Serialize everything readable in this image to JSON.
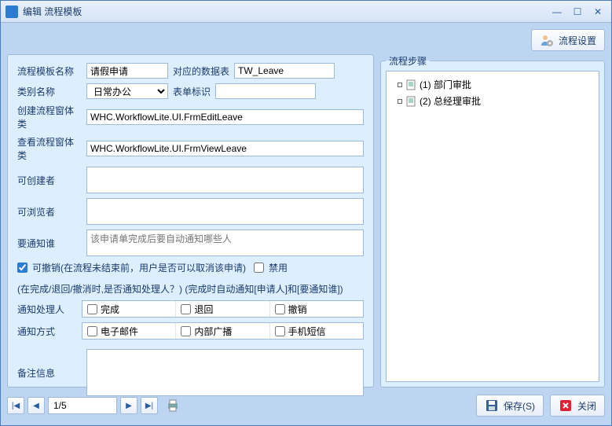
{
  "window": {
    "title": "编辑 流程模板"
  },
  "toolbar": {
    "flow_settings": "流程设置"
  },
  "labels": {
    "tpl_name": "流程模板名称",
    "data_table": "对应的数据表",
    "category": "类别名称",
    "form_id": "表单标识",
    "create_form": "创建流程窗体类",
    "view_form": "查看流程窗体类",
    "creators": "可创建者",
    "viewers": "可浏览者",
    "notify_who": "要通知谁",
    "revokable": "可撤销(在流程未结束前，用户是否可以取消该申请)",
    "disabled": "禁用",
    "notify_section": "(在完成/退回/撤消时,是否通知处理人？) (完成时自动通知[申请人]和[要通知谁])",
    "notify_handler": "通知处理人",
    "notify_method": "通知方式",
    "remark": "备注信息"
  },
  "values": {
    "tpl_name": "请假申请",
    "data_table": "TW_Leave",
    "category": "日常办公",
    "form_id": "",
    "create_form": "WHC.WorkflowLite.UI.FrmEditLeave",
    "view_form": "WHC.WorkflowLite.UI.FrmViewLeave",
    "notify_placeholder": "该申请单完成后要自动通知哪些人",
    "revokable_checked": true,
    "disabled_checked": false
  },
  "handler_opts": {
    "complete": "完成",
    "return": "退回",
    "revoke": "撤销"
  },
  "method_opts": {
    "email": "电子邮件",
    "broadcast": "内部广播",
    "sms": "手机短信"
  },
  "steps": {
    "legend": "流程步骤",
    "items": [
      {
        "label": "(1) 部门审批"
      },
      {
        "label": "(2) 总经理审批"
      }
    ]
  },
  "nav": {
    "page": "1/5"
  },
  "buttons": {
    "save": "保存(S)",
    "close": "关闭"
  }
}
